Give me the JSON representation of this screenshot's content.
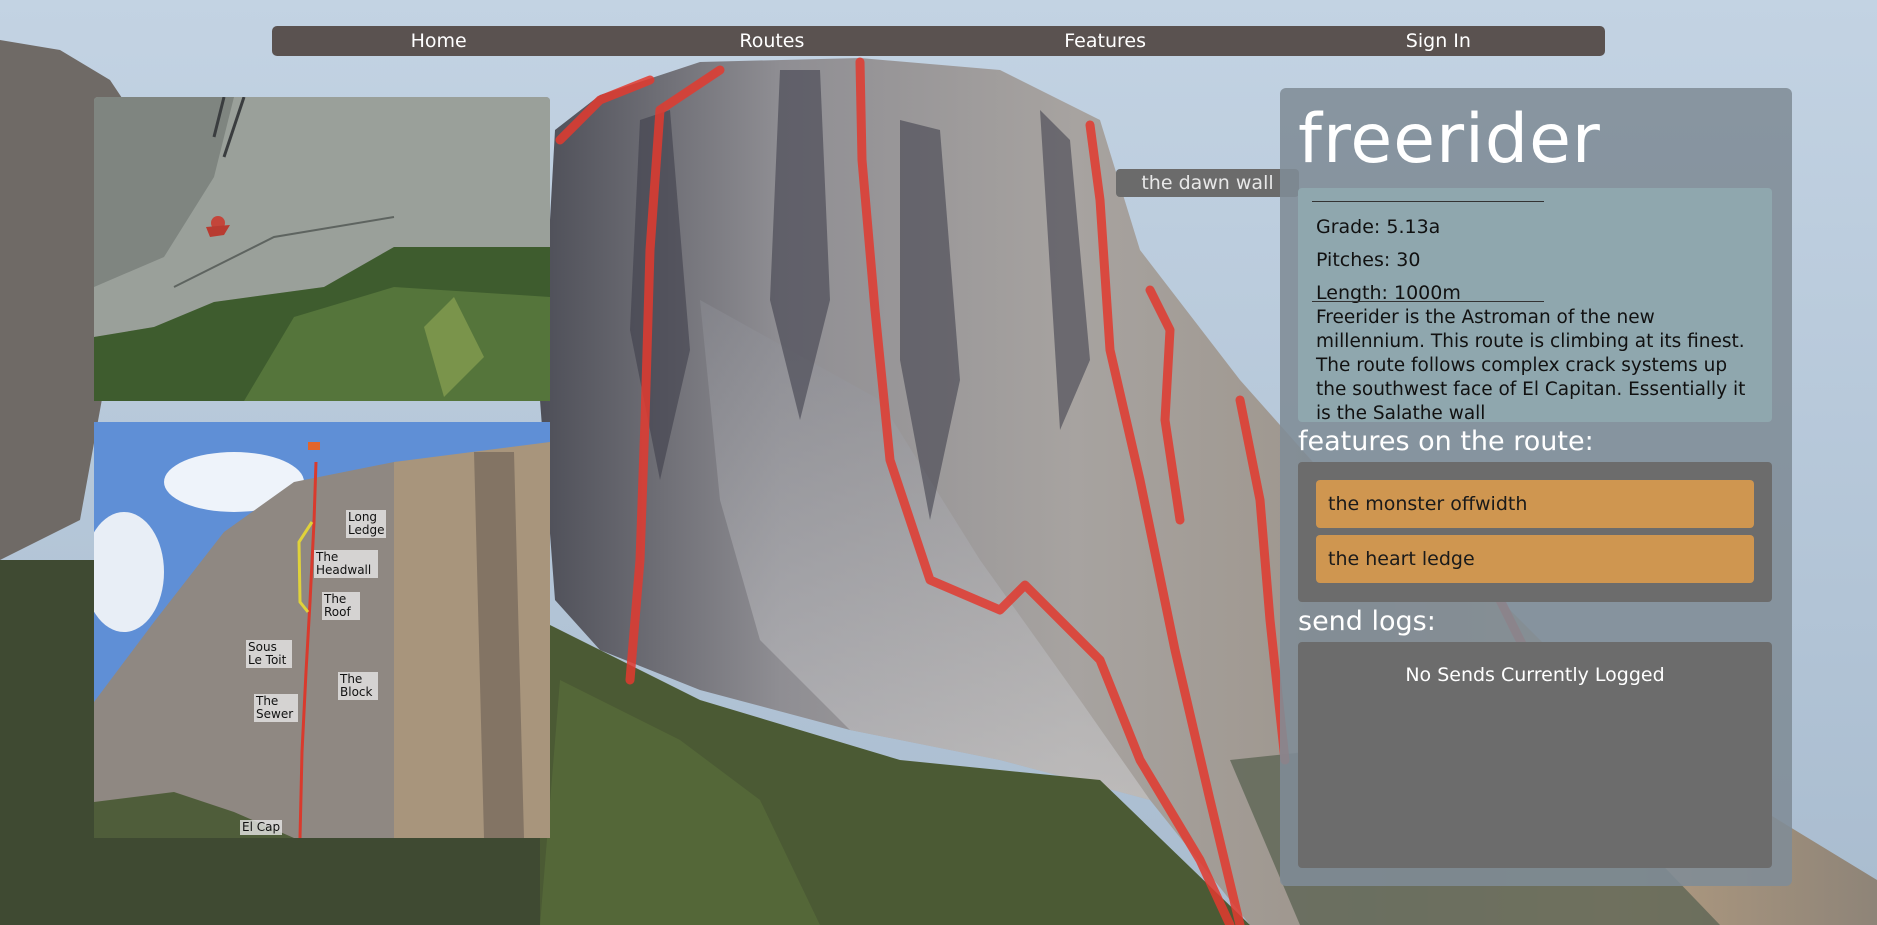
{
  "nav": {
    "items": [
      {
        "label": "Home"
      },
      {
        "label": "Routes"
      },
      {
        "label": "Features"
      },
      {
        "label": "Sign In"
      }
    ]
  },
  "tooltip": {
    "label": "the dawn wall"
  },
  "route": {
    "title": "freerider",
    "grade": "Grade: 5.13a",
    "pitches": "Pitches: 30",
    "length": "Length: 1000m",
    "description": "Freerider is the Astroman of the new millennium. This route is climbing at its finest. The route follows complex crack systems up the southwest face of El Capitan. Essentially it is the Salathe wall"
  },
  "features": {
    "heading": "features on the route:",
    "items": [
      {
        "label": "the monster offwidth"
      },
      {
        "label": "the heart ledge"
      }
    ]
  },
  "sends": {
    "heading": "send logs:",
    "empty_text": "No Sends Currently Logged"
  },
  "topo": {
    "labels": [
      {
        "text": "Long Ledge"
      },
      {
        "text": "The Headwall"
      },
      {
        "text": "The Roof"
      },
      {
        "text": "Sous Le Toit"
      },
      {
        "text": "The Block"
      },
      {
        "text": "The Sewer"
      },
      {
        "text": "El Cap"
      }
    ]
  },
  "colors": {
    "nav_bg": "#5a5250",
    "feature_bg": "#cf9650",
    "route_line": "#e23a2f",
    "panel_bg": "#808c96",
    "info_bg": "#8fa7ae"
  }
}
